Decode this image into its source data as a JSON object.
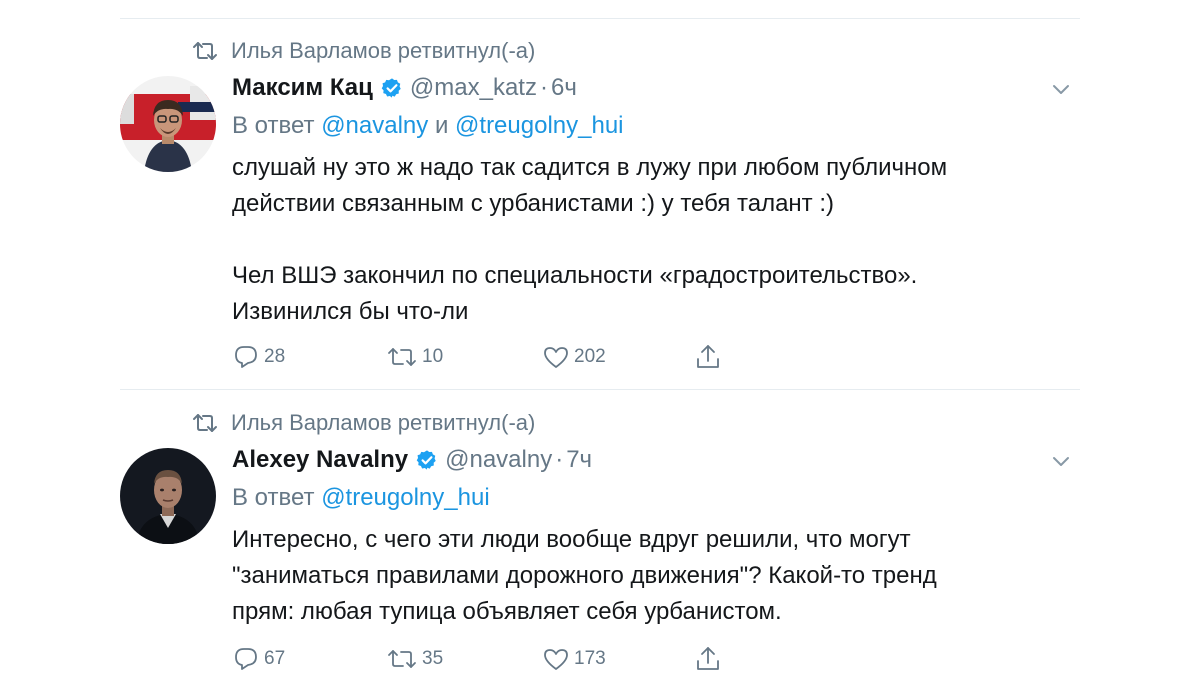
{
  "retweet_label": "Илья Варламов ретвитнул(-а)",
  "reply_prefix": "В ответ",
  "reply_conjunction": "и",
  "separator": "·",
  "tweets": [
    {
      "name": "Максим Кац",
      "handle": "@max_katz",
      "time": "6ч",
      "reply_to": [
        "@navalny",
        "@treugolny_hui"
      ],
      "text_lines": [
        "слушай ну это ж надо так садится в лужу при любом публичном",
        "действии связанным с урбанистами :) у тебя талант :)",
        "",
        "Чел ВШЭ закончил по специальности «градостроительство».",
        "Извинился бы что-ли"
      ],
      "replies": "28",
      "retweets": "10",
      "likes": "202",
      "avatar_icon": "user-avatar-photo"
    },
    {
      "name": "Alexey Navalny",
      "handle": "@navalny",
      "time": "7ч",
      "reply_to": [
        "@treugolny_hui"
      ],
      "text_lines": [
        "Интересно, с чего эти люди вообще вдруг решили, что могут",
        "\"заниматься правилами дорожного движения\"? Какой-то тренд",
        "прям: любая тупица объявляет себя урбанистом."
      ],
      "replies": "67",
      "retweets": "35",
      "likes": "173",
      "avatar_icon": "user-avatar-photo"
    }
  ],
  "colors": {
    "text": "#14171a",
    "secondary": "#657786",
    "link": "#1b95e0",
    "verified": "#1da1f2",
    "divider": "#e6ecf0"
  }
}
